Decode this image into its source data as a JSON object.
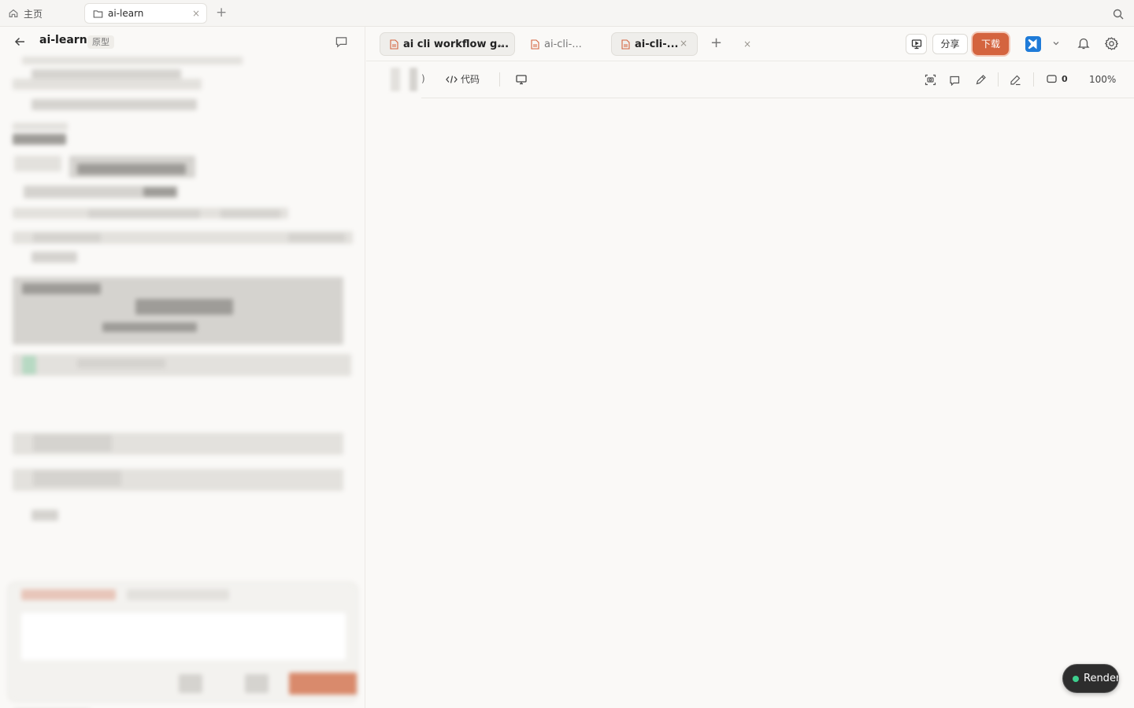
{
  "appbar": {
    "home_label": "主页",
    "project_tab_label": "ai-learn",
    "close_glyph": "×",
    "add_glyph": "+"
  },
  "left_panel": {
    "project_name": "ai-learn",
    "project_badge": "原型"
  },
  "file_tabs": [
    {
      "label": "ai cli workflow g...",
      "active": true,
      "has_dropdown": true
    },
    {
      "label": "ai-cli-...",
      "active": false,
      "close": "×"
    },
    {
      "label": "ai-cli-...",
      "active": true,
      "close": "×"
    }
  ],
  "add_tab_glyph": "+",
  "actions": {
    "share_label": "分享",
    "download_label": "下载",
    "accent_color": "#d4643f"
  },
  "toolbar": {
    "cut_glyph": ")",
    "code_label": "代码",
    "comment_count": "0",
    "zoom": "100%"
  },
  "render_pill": {
    "label": "Render",
    "status_color": "#3ecf8e"
  },
  "icons": [
    "home-icon",
    "folder-icon",
    "search-icon",
    "back-arrow-icon",
    "comment-icon",
    "file-icon",
    "present-icon",
    "vscode-icon",
    "chevron-down-icon",
    "bell-icon",
    "gear-icon",
    "code-icon",
    "monitor-icon",
    "screenshot-icon",
    "crop-icon",
    "pen-icon",
    "edit-icon"
  ]
}
